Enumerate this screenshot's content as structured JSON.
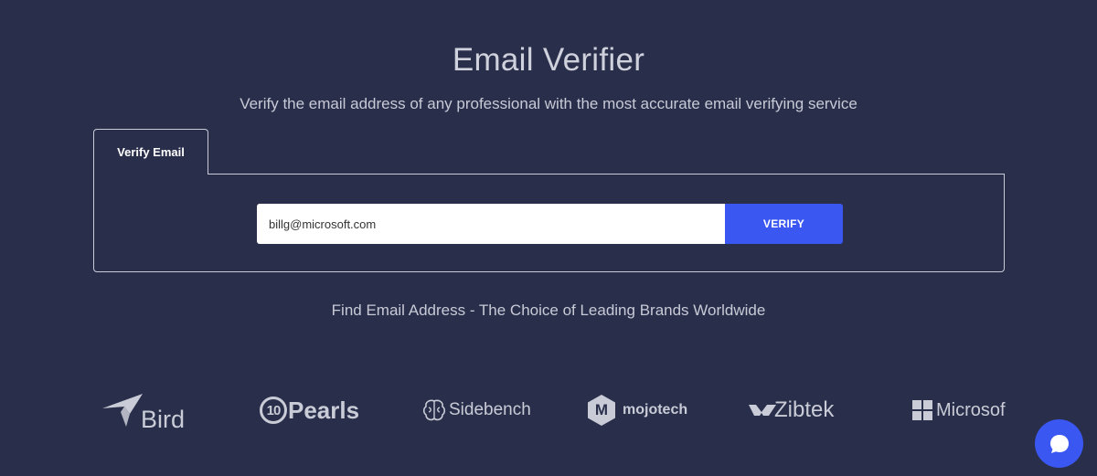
{
  "header": {
    "title": "Email Verifier",
    "subtitle": "Verify the email address of any professional with the most accurate email verifying service"
  },
  "tabs": [
    {
      "label": "Verify Email",
      "active": true
    }
  ],
  "form": {
    "email_value": "billg@microsoft.com",
    "verify_label": "VERIFY"
  },
  "brands": {
    "heading": "Find Email Address - The Choice of Leading Brands Worldwide",
    "logos": [
      {
        "name": "Bird",
        "icon": "bird-icon"
      },
      {
        "name": "Pearls",
        "mark": "10",
        "icon": "10pearls-icon"
      },
      {
        "name": "Sidebench",
        "icon": "brain-icon"
      },
      {
        "name": "mojotech",
        "mark": "M",
        "icon": "hexagon-m-icon"
      },
      {
        "name": "Zibtek",
        "icon": "zibtek-icon"
      },
      {
        "name": "Microsoft",
        "icon": "windows-grid-icon"
      }
    ]
  },
  "chat": {
    "icon": "chat-bubble-icon"
  },
  "colors": {
    "background": "#292e4b",
    "accent": "#3a57f2",
    "text": "#cfd1dc",
    "input_bg": "#ffffff"
  }
}
